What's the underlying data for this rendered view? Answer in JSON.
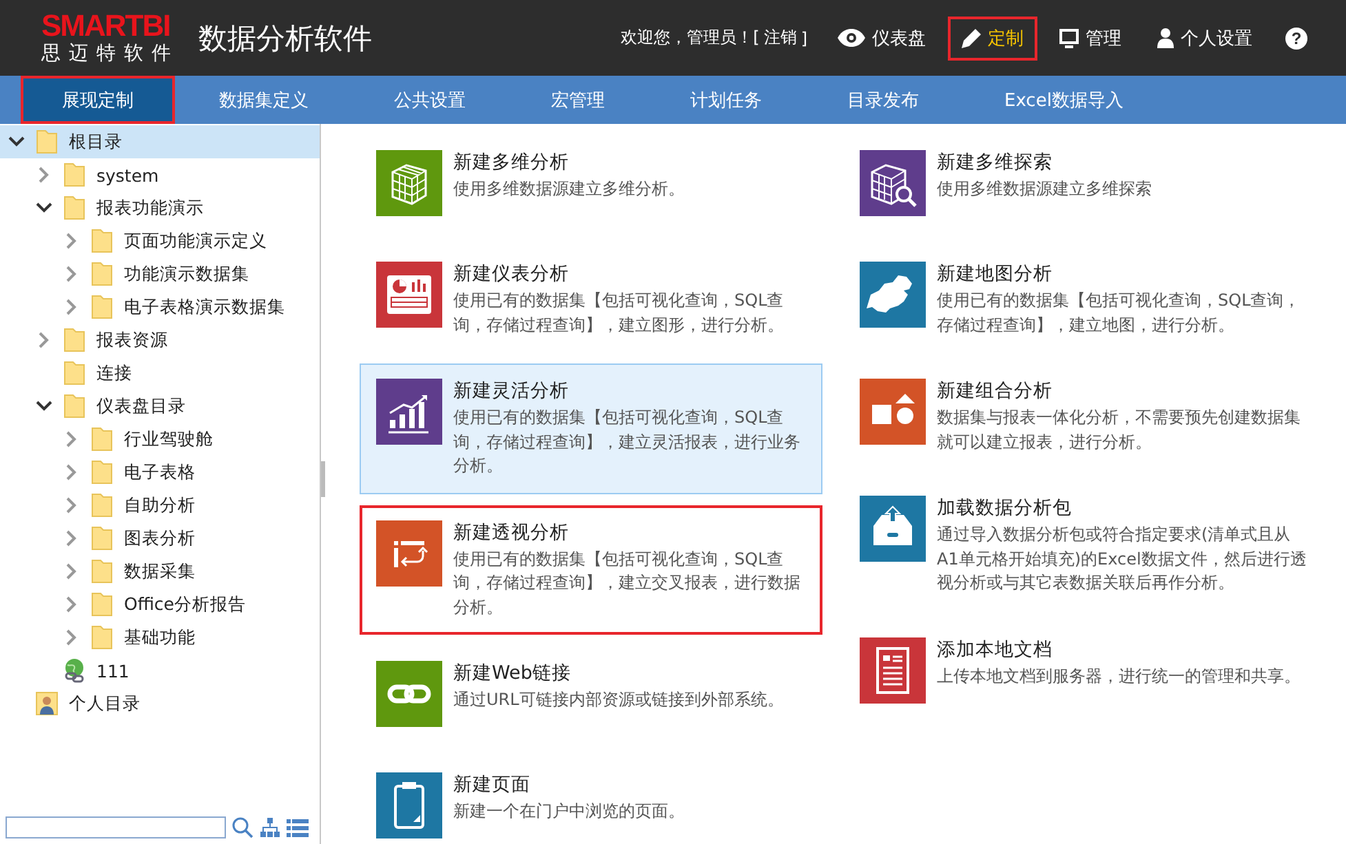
{
  "header": {
    "logo": {
      "brand": "SMARTBI",
      "tagline": "思迈特软件"
    },
    "title": "数据分析软件",
    "greeting": "欢迎您，管理员！[",
    "logout": "注销",
    "greeting_end": "]",
    "menu": [
      {
        "kind": "dashboard",
        "label": "仪表盘",
        "selected": false,
        "highlighted": false
      },
      {
        "kind": "customize",
        "label": "定制",
        "selected": true,
        "highlighted": true
      },
      {
        "kind": "manage",
        "label": "管理",
        "selected": false,
        "highlighted": false
      },
      {
        "kind": "settings",
        "label": "个人设置",
        "selected": false,
        "highlighted": false
      }
    ],
    "help": "?"
  },
  "tabs": [
    {
      "label": "展现定制",
      "selected": true,
      "highlighted": true
    },
    {
      "label": "数据集定义",
      "selected": false,
      "highlighted": false
    },
    {
      "label": "公共设置",
      "selected": false,
      "highlighted": false
    },
    {
      "label": "宏管理",
      "selected": false,
      "highlighted": false
    },
    {
      "label": "计划任务",
      "selected": false,
      "highlighted": false
    },
    {
      "label": "目录发布",
      "selected": false,
      "highlighted": false
    },
    {
      "label": "Excel数据导入",
      "selected": false,
      "highlighted": false
    }
  ],
  "tree": {
    "items": [
      {
        "kind": "folder",
        "label": "根目录",
        "selected": true,
        "expandable": true,
        "expanded": true,
        "children": [
          {
            "kind": "folder",
            "label": "system",
            "selected": false,
            "expandable": true,
            "expanded": false
          },
          {
            "kind": "folder",
            "label": "报表功能演示",
            "selected": false,
            "expandable": true,
            "expanded": true,
            "children": [
              {
                "kind": "folder",
                "label": "页面功能演示定义",
                "selected": false,
                "expandable": true,
                "expanded": false
              },
              {
                "kind": "folder",
                "label": "功能演示数据集",
                "selected": false,
                "expandable": true,
                "expanded": false
              },
              {
                "kind": "folder",
                "label": "电子表格演示数据集",
                "selected": false,
                "expandable": true,
                "expanded": false
              }
            ]
          },
          {
            "kind": "folder",
            "label": "报表资源",
            "selected": false,
            "expandable": true,
            "expanded": false
          },
          {
            "kind": "folder",
            "label": "连接",
            "selected": false,
            "expandable": false
          },
          {
            "kind": "folder",
            "label": "仪表盘目录",
            "selected": false,
            "expandable": true,
            "expanded": true,
            "children": [
              {
                "kind": "folder",
                "label": "行业驾驶舱",
                "selected": false,
                "expandable": true,
                "expanded": false
              },
              {
                "kind": "folder",
                "label": "电子表格",
                "selected": false,
                "expandable": true,
                "expanded": false
              },
              {
                "kind": "folder",
                "label": "自助分析",
                "selected": false,
                "expandable": true,
                "expanded": false
              },
              {
                "kind": "folder",
                "label": "图表分析",
                "selected": false,
                "expandable": true,
                "expanded": false
              },
              {
                "kind": "folder",
                "label": "数据采集",
                "selected": false,
                "expandable": true,
                "expanded": false
              },
              {
                "kind": "folder",
                "label": "Office分析报告",
                "selected": false,
                "expandable": true,
                "expanded": false
              },
              {
                "kind": "folder",
                "label": "基础功能",
                "selected": false,
                "expandable": true,
                "expanded": false
              }
            ]
          },
          {
            "kind": "link",
            "label": "111",
            "selected": false,
            "expandable": false
          }
        ]
      },
      {
        "kind": "personal",
        "label": "个人目录",
        "selected": false,
        "expandable": false
      }
    ]
  },
  "columns": [
    [
      {
        "kind": "cube",
        "color": "#5f980e",
        "title": "新建多维分析",
        "description": "使用多维数据源建立多维分析。",
        "hovered": false,
        "highlighted": false
      },
      {
        "kind": "dashboard",
        "color": "#c9353a",
        "title": "新建仪表分析",
        "description": "使用已有的数据集【包括可视化查询，SQL查询，存储过程查询】，建立图形，进行分析。",
        "hovered": false,
        "highlighted": false
      },
      {
        "kind": "trend",
        "color": "#5f3d8c",
        "title": "新建灵活分析",
        "description": "使用已有的数据集【包括可视化查询，SQL查询，存储过程查询】，建立灵活报表，进行业务分析。",
        "hovered": true,
        "highlighted": false
      },
      {
        "kind": "pivot",
        "color": "#d35327",
        "title": "新建透视分析",
        "description": "使用已有的数据集【包括可视化查询，SQL查询，存储过程查询】，建立交叉报表，进行数据分析。",
        "hovered": false,
        "highlighted": true
      },
      {
        "kind": "link",
        "color": "#5f980e",
        "title": "新建Web链接",
        "description": "通过URL可链接内部资源或链接到外部系统。",
        "hovered": false,
        "highlighted": false
      },
      {
        "kind": "page",
        "color": "#1e77a3",
        "title": "新建页面",
        "description": "新建一个在门户中浏览的页面。",
        "hovered": false,
        "highlighted": false
      }
    ],
    [
      {
        "kind": "cube-search",
        "color": "#5f3d8c",
        "title": "新建多维探索",
        "description": "使用多维数据源建立多维探索",
        "hovered": false,
        "highlighted": false
      },
      {
        "kind": "map",
        "color": "#1e77a3",
        "title": "新建地图分析",
        "description": "使用已有的数据集【包括可视化查询，SQL查询，存储过程查询】，建立地图，进行分析。",
        "hovered": false,
        "highlighted": false
      },
      {
        "kind": "shapes",
        "color": "#d35327",
        "title": "新建组合分析",
        "description": "数据集与报表一体化分析，不需要预先创建数据集就可以建立报表，进行分析。",
        "hovered": false,
        "highlighted": false
      },
      {
        "kind": "upload",
        "color": "#1e77a3",
        "title": "加载数据分析包",
        "description": "通过导入数据分析包或符合指定要求(清单式且从A1单元格开始填充)的Excel数据文件，然后进行透视分析或与其它表数据关联后再作分析。",
        "hovered": false,
        "highlighted": false
      },
      {
        "kind": "document",
        "color": "#c9353a",
        "title": "添加本地文档",
        "description": "上传本地文档到服务器，进行统一的管理和共享。",
        "hovered": false,
        "highlighted": false
      }
    ]
  ]
}
